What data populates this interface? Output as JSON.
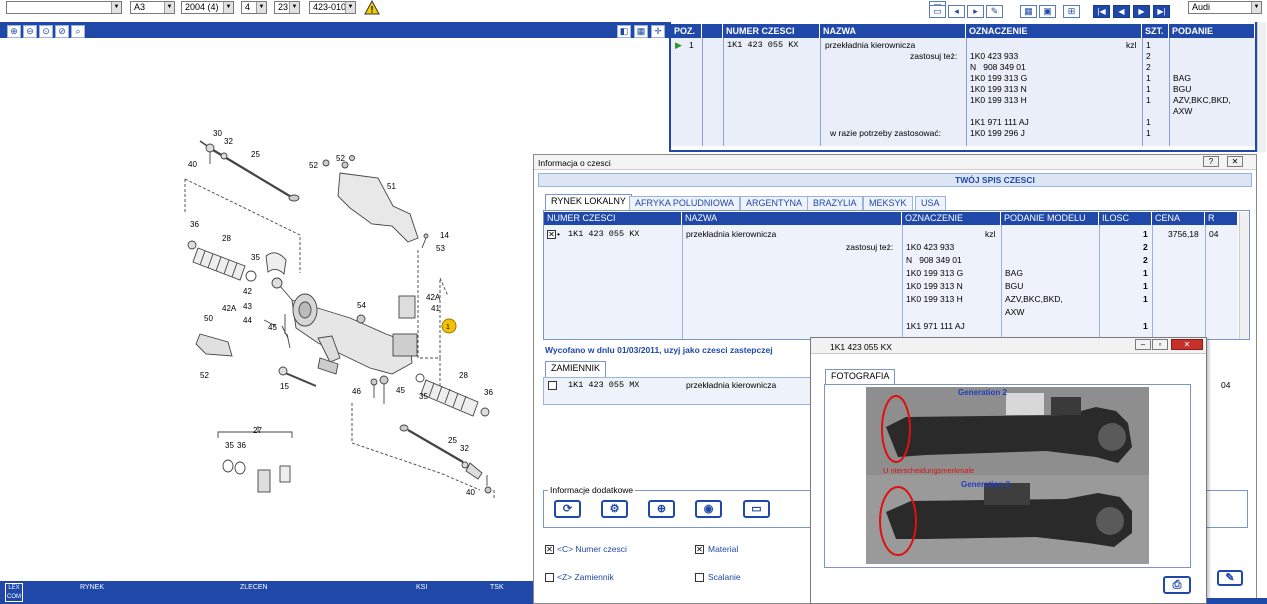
{
  "toolbar": {
    "sel_blank": "",
    "sel_model": "A3",
    "sel_year": "2004 (4)",
    "sel_num": "4",
    "sel_group": "23",
    "sel_subgroup": "423-010",
    "warning_icon": "warning-icon",
    "brand": "Audi"
  },
  "diagram": {
    "labels": [
      "30",
      "32",
      "25",
      "40",
      "52",
      "52",
      "51",
      "14",
      "53",
      "36",
      "28",
      "35",
      "42",
      "42A",
      "43",
      "44",
      "45",
      "50",
      "52",
      "54",
      "42A",
      "41",
      "1",
      "15",
      "46",
      "45",
      "28",
      "35",
      "36",
      "27",
      "35",
      "36",
      "25",
      "32",
      "40"
    ]
  },
  "top_table": {
    "headers": [
      "POZ.",
      "NUMER CZESCI",
      "NAZWA",
      "OZNACZENIE",
      "SZT.",
      "PODANIE MODELU"
    ],
    "rows": [
      {
        "poz": "1",
        "num": "1K1 423 055 KX",
        "nazwa": "przekładnia kierownicza",
        "ozn": "",
        "unit": "kzl",
        "szt": "1",
        "model": ""
      },
      {
        "poz": "",
        "num": "",
        "nazwa": "zastosuj też:",
        "ozn": "1K0 423 933",
        "unit": "",
        "szt": "2",
        "model": ""
      },
      {
        "poz": "",
        "num": "",
        "nazwa": "",
        "ozn": "N   908 349 01",
        "unit": "",
        "szt": "2",
        "model": ""
      },
      {
        "poz": "",
        "num": "",
        "nazwa": "",
        "ozn": "1K0 199 313 G",
        "unit": "",
        "szt": "1",
        "model": "BAG"
      },
      {
        "poz": "",
        "num": "",
        "nazwa": "",
        "ozn": "1K0 199 313 N",
        "unit": "",
        "szt": "1",
        "model": "BGU"
      },
      {
        "poz": "",
        "num": "",
        "nazwa": "",
        "ozn": "1K0 199 313 H",
        "unit": "",
        "szt": "1",
        "model": "AZV,BKC,BKD,"
      },
      {
        "poz": "",
        "num": "",
        "nazwa": "",
        "ozn": "",
        "unit": "",
        "szt": "",
        "model": "AXW"
      },
      {
        "poz": "",
        "num": "",
        "nazwa": "",
        "ozn": "1K1 971 111 AJ",
        "unit": "",
        "szt": "1",
        "model": ""
      },
      {
        "poz": "",
        "num": "",
        "nazwa": "w razie potrzeby zastosować:",
        "ozn": "1K0 199 296 J",
        "unit": "",
        "szt": "1",
        "model": ""
      }
    ]
  },
  "info_window": {
    "title": "Informacja o czesci",
    "subtitle": "TWÓJ SPIS CZESCI",
    "tabs": [
      "RYNEK LOKALNY",
      "AFRYKA POLUDNIOWA",
      "ARGENTYNA",
      "BRAZYLIA",
      "MEKSYK",
      "USA"
    ],
    "headers": [
      "NUMER CZESCI",
      "NAZWA",
      "OZNACZENIE",
      "PODANIE MODELU",
      "ILOSC",
      "CENA",
      "R"
    ],
    "rows": [
      {
        "num": "1K1 423 055 KX",
        "nazwa": "przekładnia kierownicza",
        "ozn": "",
        "unit": "kzl",
        "model": "",
        "ilosc": "1",
        "cena": "3756,18",
        "r": "04"
      },
      {
        "num": "",
        "nazwa": "zastosuj też:",
        "ozn": "1K0 423 933",
        "unit": "",
        "model": "",
        "ilosc": "2",
        "cena": "",
        "r": ""
      },
      {
        "num": "",
        "nazwa": "",
        "ozn": "N   908 349 01",
        "unit": "",
        "model": "",
        "ilosc": "2",
        "cena": "",
        "r": ""
      },
      {
        "num": "",
        "nazwa": "",
        "ozn": "1K0 199 313 G",
        "unit": "",
        "model": "BAG",
        "ilosc": "1",
        "cena": "",
        "r": ""
      },
      {
        "num": "",
        "nazwa": "",
        "ozn": "1K0 199 313 N",
        "unit": "",
        "model": "BGU",
        "ilosc": "1",
        "cena": "",
        "r": ""
      },
      {
        "num": "",
        "nazwa": "",
        "ozn": "1K0 199 313 H",
        "unit": "",
        "model": "AZV,BKC,BKD,",
        "ilosc": "1",
        "cena": "",
        "r": ""
      },
      {
        "num": "",
        "nazwa": "",
        "ozn": "",
        "unit": "",
        "model": "AXW",
        "ilosc": "",
        "cena": "",
        "r": ""
      },
      {
        "num": "",
        "nazwa": "",
        "ozn": "1K1 971 111 AJ",
        "unit": "",
        "model": "",
        "ilosc": "1",
        "cena": "",
        "r": ""
      }
    ],
    "withdrawn": "Wycofano w dnlu 01/03/2011, uzyj jako czesci zastepczej",
    "replacement_tab": "ZAMIENNIK",
    "replacement_row": {
      "num": "1K1 423 055 MX",
      "nazwa": "przekładnia kierownicza",
      "r": "04"
    },
    "extra_label": "Informacje dodatkowe",
    "check_num": "<C> Numer czesci",
    "check_material": "Material",
    "check_repl": "<Z> Zamiennik",
    "check_merge": "Scalanie"
  },
  "photo_window": {
    "title": "1K1 423 055 KX",
    "tab": "FOTOGRAFIA",
    "gen2": "Generation 2",
    "gen3": "Generation 3",
    "caption": "U nterscheidungsmerkmale"
  },
  "status_bar": {
    "logo_top": "LEX",
    "logo_bottom": "COM",
    "items": [
      "RYNEK",
      "ZLECEN",
      "KSI",
      "TSK"
    ]
  }
}
